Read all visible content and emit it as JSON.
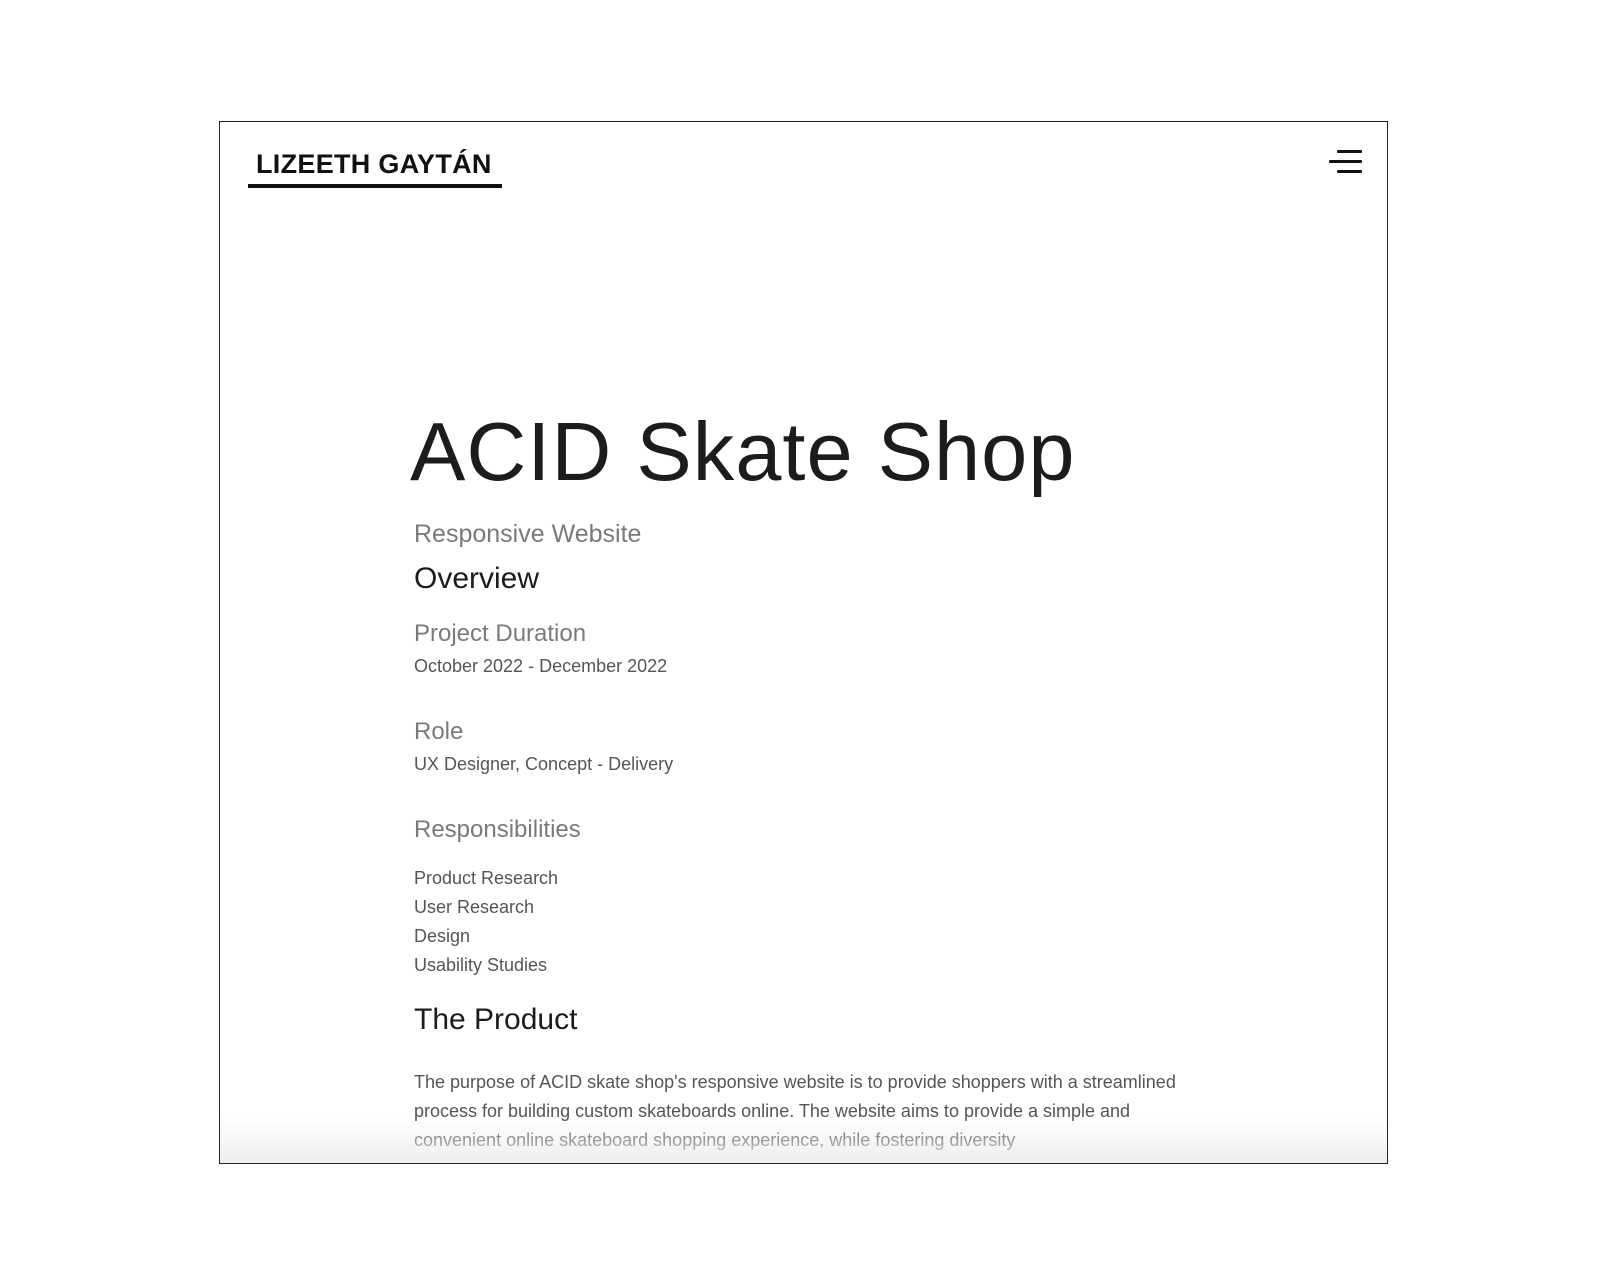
{
  "header": {
    "logo_text": "LIZEETH GAYTÁN",
    "menu_icon": "hamburger-menu-icon"
  },
  "hero": {
    "title": "ACID Skate Shop",
    "subtitle": "Responsive Website"
  },
  "overview": {
    "heading": "Overview",
    "duration_label": "Project Duration",
    "duration_value": "October 2022 - December 2022",
    "role_label": "Role",
    "role_value": "UX Designer, Concept - Delivery",
    "responsibilities_label": "Responsibilities",
    "responsibilities": [
      "Product Research",
      "User Research",
      "Design",
      "Usability Studies"
    ]
  },
  "product": {
    "heading": "The Product",
    "paragraph": "The purpose of ACID skate shop's responsive website is to provide shoppers with a streamlined process for building custom skateboards online. The website aims to provide a simple and convenient online skateboard shopping experience, while fostering diversity"
  }
}
